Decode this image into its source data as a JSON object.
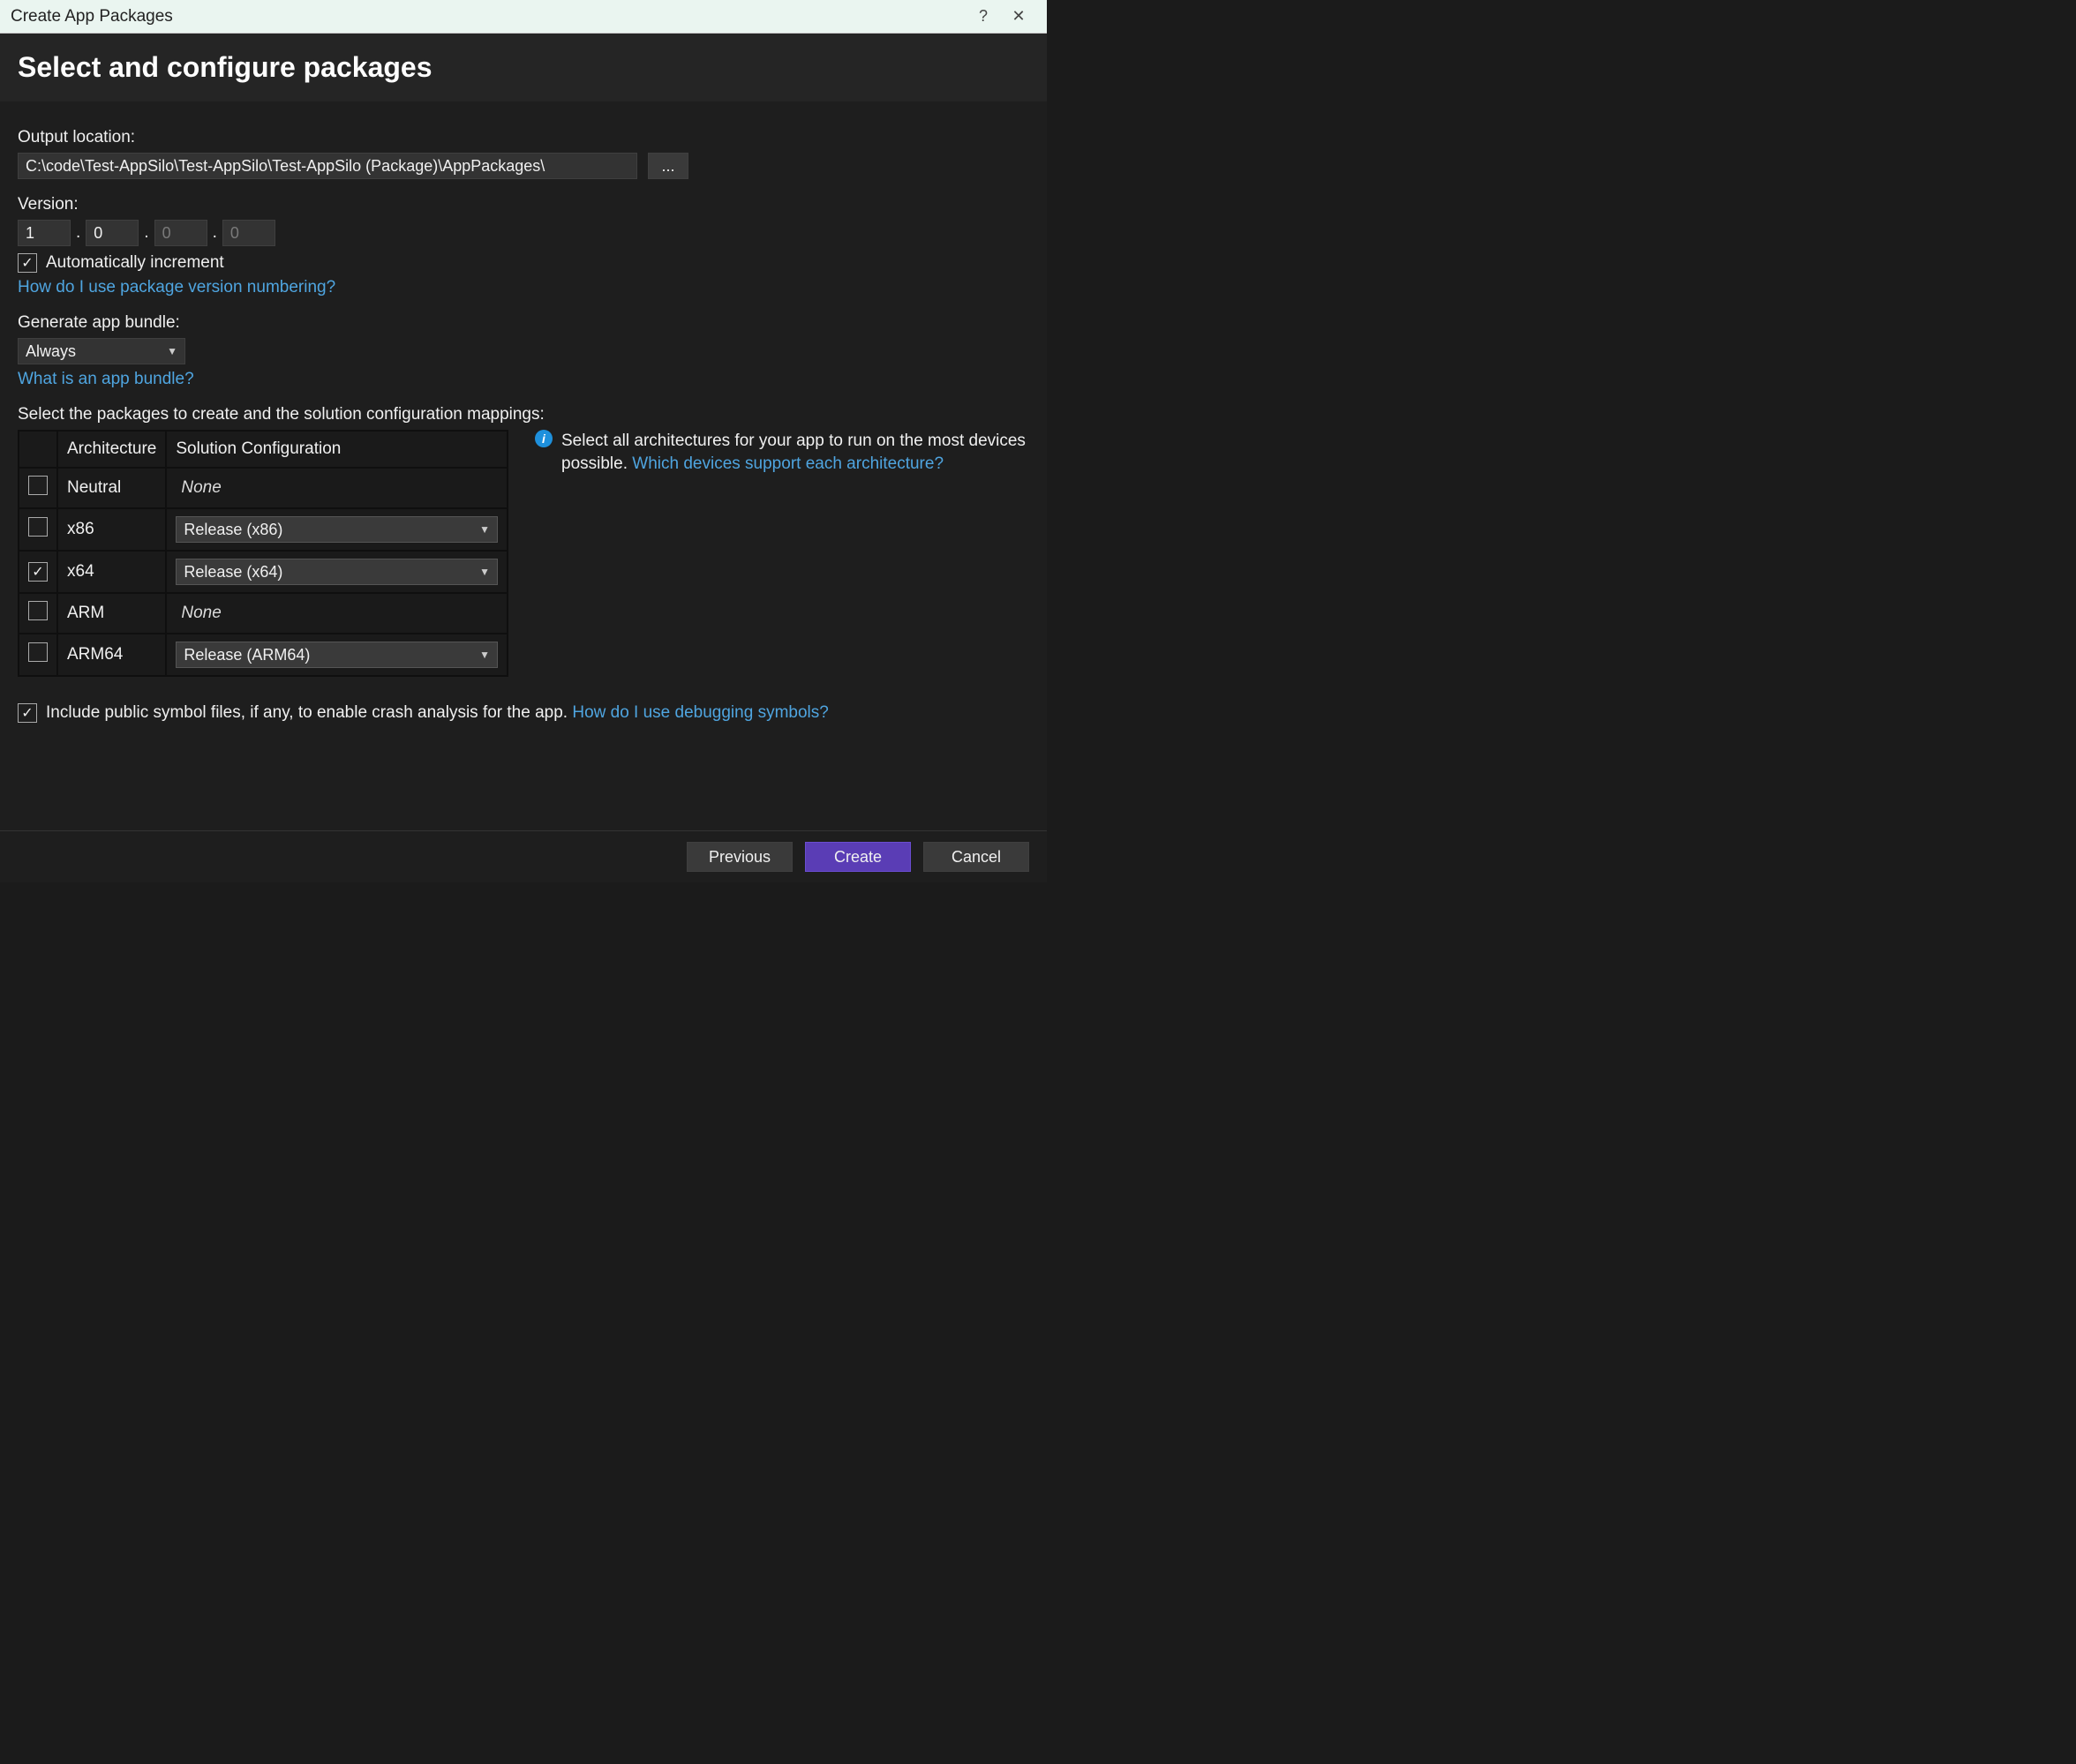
{
  "window": {
    "title": "Create App Packages",
    "help": "?",
    "close": "✕"
  },
  "heading": "Select and configure packages",
  "output": {
    "label": "Output location:",
    "value": "C:\\code\\Test-AppSilo\\Test-AppSilo\\Test-AppSilo (Package)\\AppPackages\\",
    "browse": "..."
  },
  "version": {
    "label": "Version:",
    "major": "1",
    "minor": "0",
    "build": "0",
    "rev": "0",
    "auto_label": "Automatically increment",
    "auto_checked": true,
    "help_link": "How do I use package version numbering?"
  },
  "bundle": {
    "label": "Generate app bundle:",
    "value": "Always",
    "help_link": "What is an app bundle?"
  },
  "packages": {
    "label": "Select the packages to create and the solution configuration mappings:",
    "col_arch": "Architecture",
    "col_conf": "Solution Configuration",
    "rows": [
      {
        "arch": "Neutral",
        "conf": "None",
        "checked": false,
        "editable": false
      },
      {
        "arch": "x86",
        "conf": "Release (x86)",
        "checked": false,
        "editable": true
      },
      {
        "arch": "x64",
        "conf": "Release (x64)",
        "checked": true,
        "editable": true
      },
      {
        "arch": "ARM",
        "conf": "None",
        "checked": false,
        "editable": false
      },
      {
        "arch": "ARM64",
        "conf": "Release (ARM64)",
        "checked": false,
        "editable": true
      }
    ],
    "info_text_1": "Select all architectures for your app to run on the most devices possible. ",
    "info_link": "Which devices support each architecture?"
  },
  "symbols": {
    "checked": true,
    "label": "Include public symbol files, if any, to enable crash analysis for the app. ",
    "link": "How do I use debugging symbols?"
  },
  "footer": {
    "previous": "Previous",
    "create": "Create",
    "cancel": "Cancel"
  }
}
